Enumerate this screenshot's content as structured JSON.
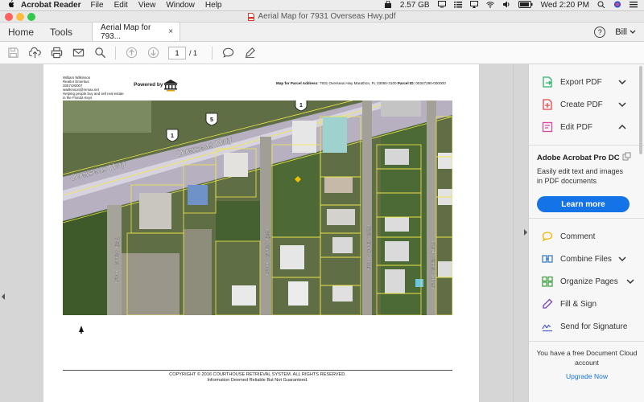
{
  "menubar": {
    "app_name": "Acrobat Reader",
    "items": [
      "File",
      "Edit",
      "View",
      "Window",
      "Help"
    ],
    "memory": "2.57 GB",
    "clock": "Wed 2:20 PM"
  },
  "window": {
    "title": "Aerial Map for 7931 Overseas Hwy.pdf"
  },
  "tabs": {
    "home": "Home",
    "tools": "Tools",
    "document": "Aerial Map for 793...",
    "close": "×",
    "help": "?",
    "user": "Bill"
  },
  "toolbar": {
    "page_current": "1",
    "page_total": "/ 1"
  },
  "page": {
    "header_left": "William Wilkinson\nRealtor Emeritus\n3057430007\nwwilkinson@remax.net\nHelping people buy and sell real estate in the Florida Keys",
    "powered_by": "Powered by",
    "parcel_label": "Map for Parcel Address:",
    "parcel_value": "7931 Overseas Hwy Marathon, FL 33050-3100",
    "parcel_id_label": "Parcel ID:",
    "parcel_id_value": "00347290-000000",
    "map_labels": {
      "overseas_hwy_1": "Overseas Hwy",
      "overseas_hwy_2": "Overseas Hwy",
      "route_1a": "1",
      "route_1b": "1",
      "route_5": "5",
      "street_79th": "79th Street Ocean",
      "street_80th": "80th Street Ocean",
      "street_81st": "81st Street Ocean",
      "street_82nd": "82nd Street Ocean"
    },
    "footer_line1": "COPYRIGHT © 2016 COURTHOUSE RETRIEVAL SYSTEM. ALL RIGHTS RESERVED.",
    "footer_line2": "Information Deemed Reliable But Not Guaranteed."
  },
  "right_panel": {
    "export_pdf": "Export PDF",
    "create_pdf": "Create PDF",
    "edit_pdf": "Edit PDF",
    "promo_title": "Adobe Acrobat Pro DC",
    "promo_desc": "Easily edit text and images in PDF documents",
    "learn_more": "Learn more",
    "comment": "Comment",
    "combine_files": "Combine Files",
    "organize_pages": "Organize Pages",
    "fill_sign": "Fill & Sign",
    "send_signature": "Send for Signature",
    "cloud_note": "You have a free Document Cloud account",
    "upgrade": "Upgrade Now"
  },
  "colors": {
    "accent": "#1473e6",
    "export_icon": "#2ab56d",
    "create_icon": "#e3474c",
    "edit_icon": "#d849a3",
    "comment_icon": "#f5b400",
    "combine_icon": "#2f74c0",
    "organize_icon": "#3a9e3a",
    "fill_icon": "#7a3fbf",
    "send_icon": "#4a5bd4"
  }
}
